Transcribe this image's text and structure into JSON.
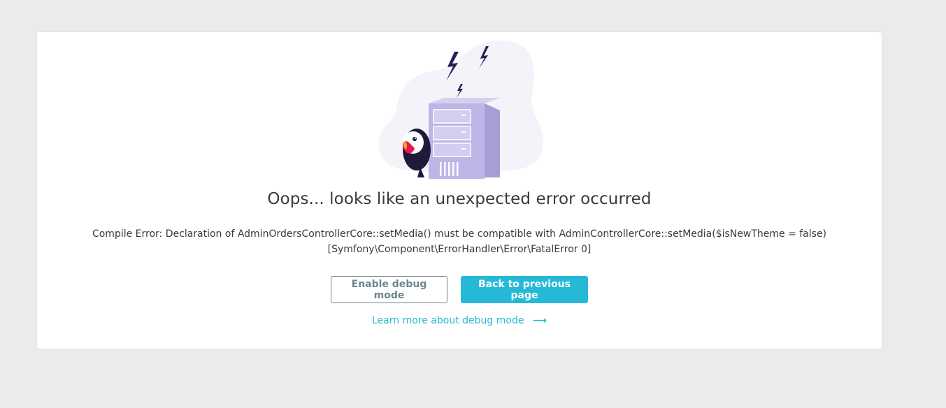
{
  "error_page": {
    "title": "Oops... looks like an unexpected error occurred",
    "message_line1": "Compile Error: Declaration of AdminOrdersControllerCore::setMedia() must be compatible with AdminControllerCore::setMedia($isNewTheme = false)",
    "message_line2": "[Symfony\\Component\\ErrorHandler\\Error\\FatalError 0]",
    "enable_debug_label": "Enable debug mode",
    "back_label": "Back to previous page",
    "learn_more_label": "Learn more about debug mode",
    "learn_more_arrow": "⟶"
  },
  "icons": {
    "illustration": "server-error-illustration",
    "mascot": "puffin-mascot-icon",
    "lightning": "lightning-bolt-icon",
    "arrow": "arrow-right-icon"
  },
  "colors": {
    "background": "#eaebed",
    "card": "#ffffff",
    "text": "#363a41",
    "primary": "#25b9d7",
    "secondary_border": "#6c868e",
    "server": "#beb6e6",
    "blob": "#f4f3fa",
    "bolt": "#25205a"
  }
}
